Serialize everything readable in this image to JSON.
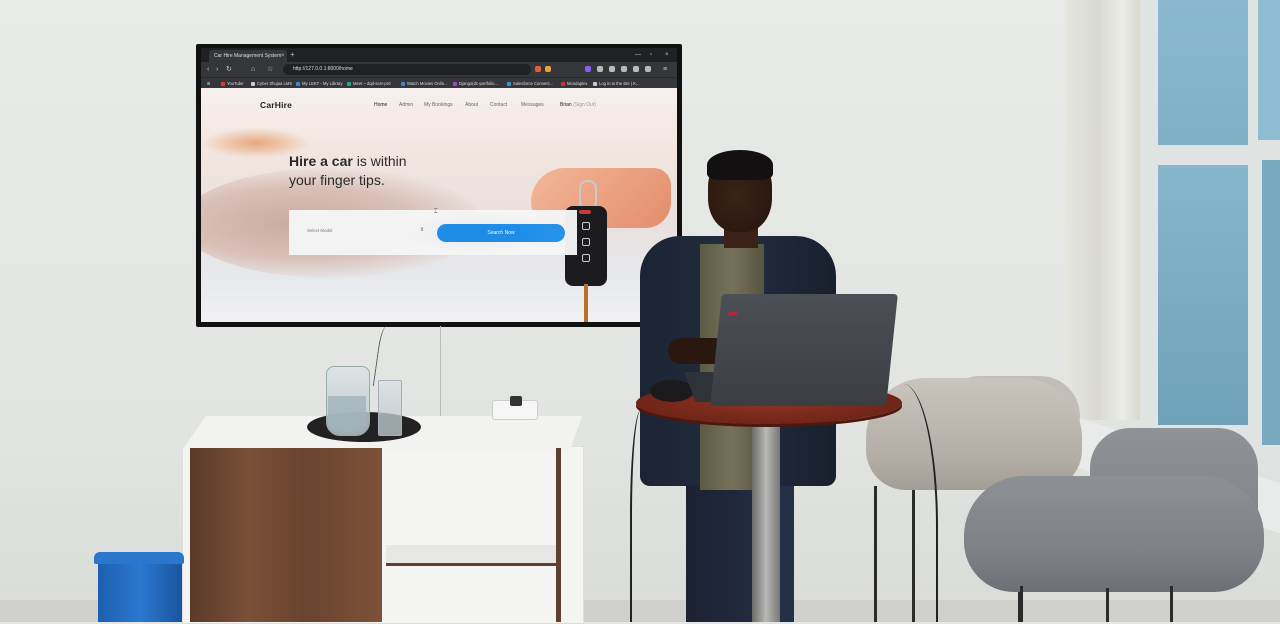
{
  "browser": {
    "tab_title": "Car Hire Management System",
    "tab_close": "×",
    "new_tab": "+",
    "window_controls": [
      "—",
      "▫",
      "×"
    ],
    "url": "http://127.0.0.1:8000/home",
    "bookmarks": [
      "YouTube",
      "Cyber Shujaa LMS",
      "My LEKT - My Library",
      "Meet – dqd-scsr-prd",
      "Watch Movies Onlin...",
      "Django(dc-portfolio...",
      "Salesforce Connect...",
      "Moodaplex",
      "Log in to the site | K..."
    ]
  },
  "site": {
    "logo": "CarHire",
    "nav": [
      "Home",
      "Admin",
      "My Bookings",
      "About",
      "Contact",
      "Messages"
    ],
    "user_nav": {
      "name": "Brian",
      "action": "(Sign Out)"
    },
    "hero": {
      "bold1": "Hire a car",
      "rest1": " is within",
      "line2": "your finger tips."
    },
    "search": {
      "select_placeholder": "Select Model",
      "button": "Search Now"
    }
  },
  "colors": {
    "accent": "#1e8fec",
    "tv_bezel": "#111111",
    "browser_chrome": "#35363a"
  }
}
